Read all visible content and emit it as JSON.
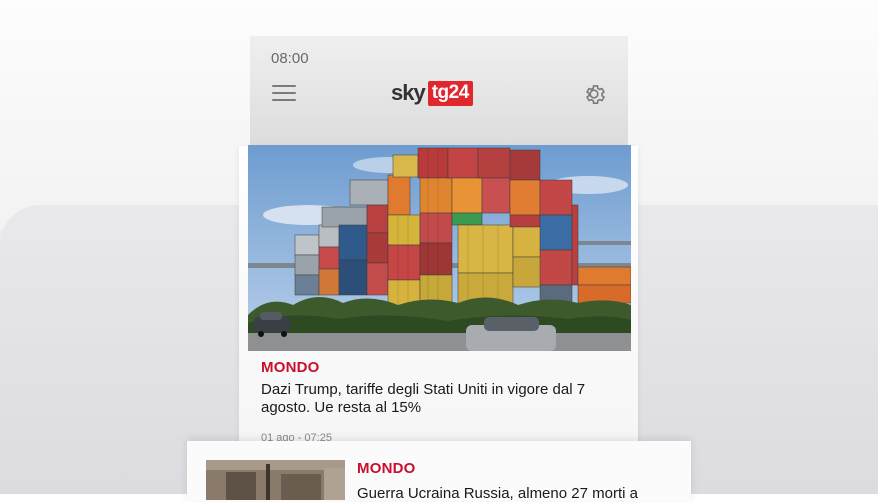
{
  "status_bar": {
    "time": "08:00"
  },
  "header": {
    "logo_sky": "sky",
    "logo_tg": "tg24",
    "menu_icon": "hamburger-menu-icon",
    "settings_icon": "gear-icon"
  },
  "articles": [
    {
      "category": "MONDO",
      "headline": "Dazi Trump, tariffe degli Stati Uniti in vigore dal 7 agosto. Ue resta al 15%",
      "date": "01 ago - 07:25",
      "image": "shipping-containers-photo"
    },
    {
      "category": "MONDO",
      "headline": "Guerra Ucraina Russia, almeno 27 morti a",
      "image": "damaged-building-photo"
    }
  ],
  "colors": {
    "accent": "#c8102e",
    "logo_red": "#e1262d",
    "header_bg": "#e6e6e6"
  }
}
